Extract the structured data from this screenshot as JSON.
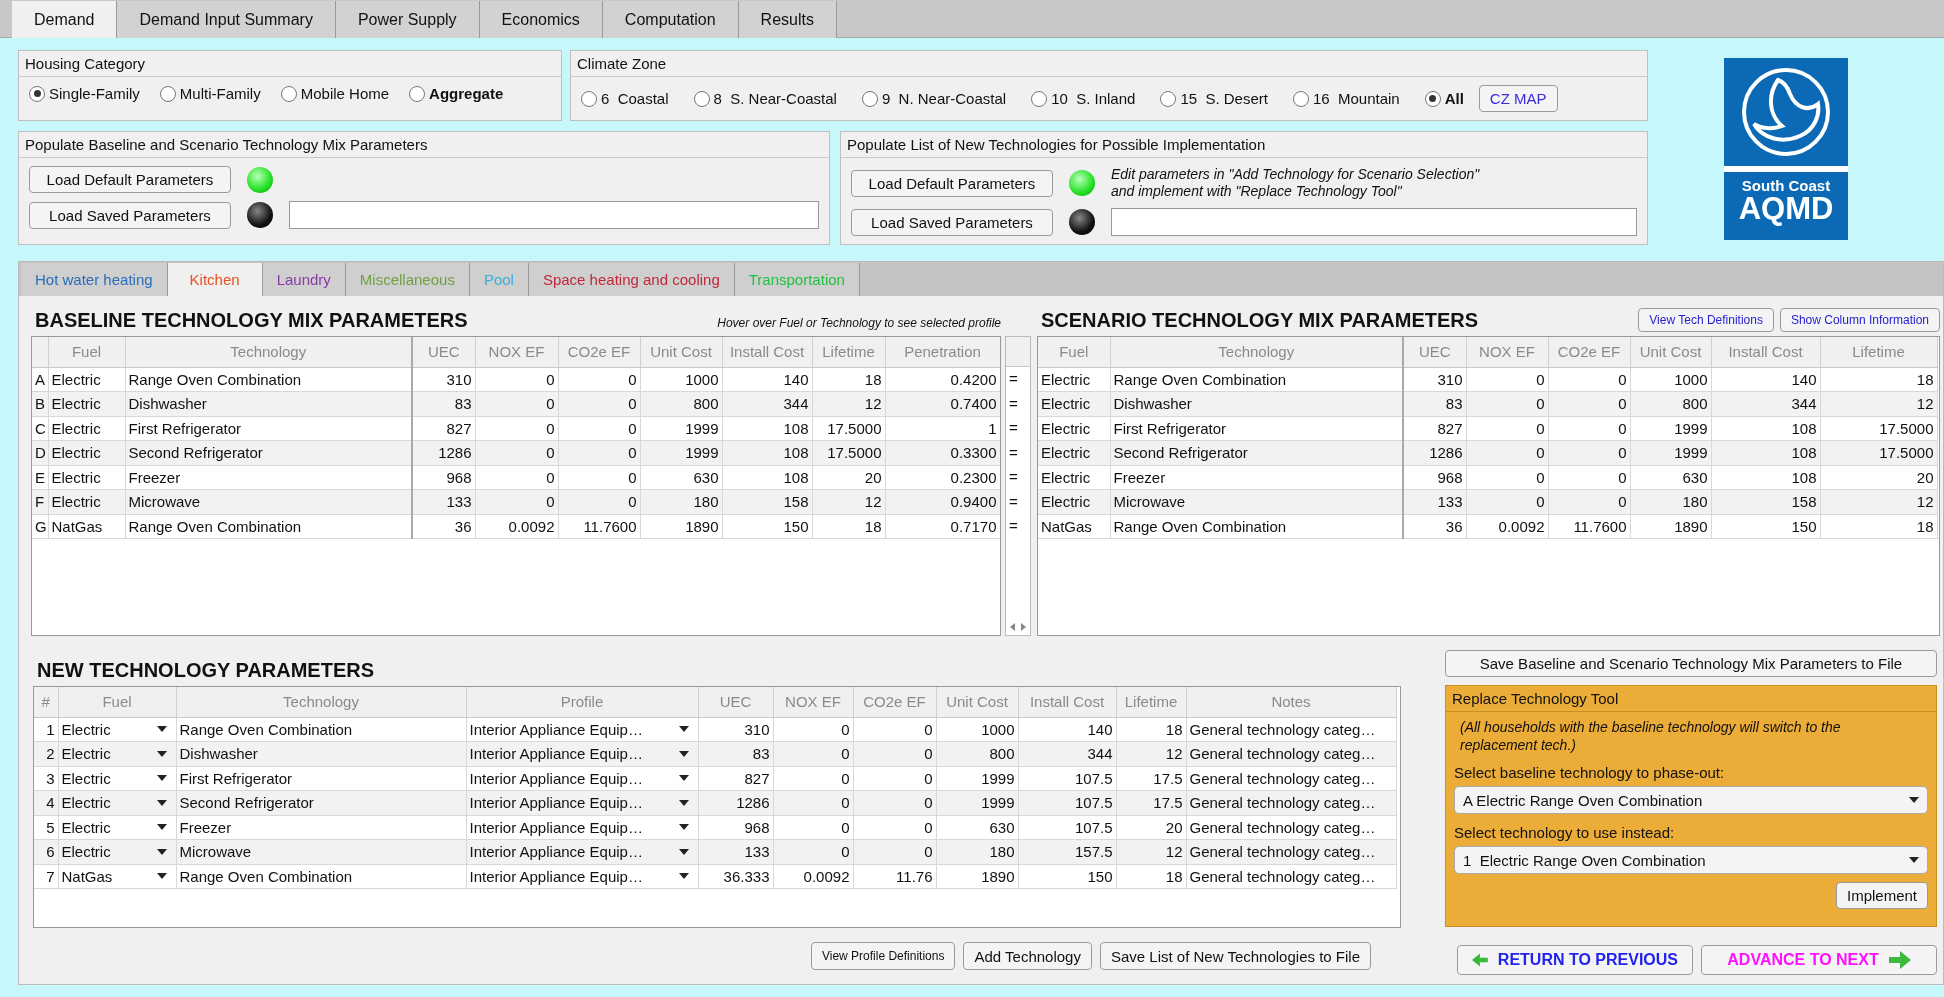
{
  "top_tabs": [
    {
      "label": "Demand",
      "selected": true
    },
    {
      "label": "Demand Input Summary",
      "selected": false
    },
    {
      "label": "Power Supply",
      "selected": false
    },
    {
      "label": "Economics",
      "selected": false
    },
    {
      "label": "Computation",
      "selected": false
    },
    {
      "label": "Results",
      "selected": false
    }
  ],
  "housing_category": {
    "title": "Housing Category",
    "options": [
      {
        "label": "Single-Family",
        "selected": true,
        "kind": "single"
      },
      {
        "label": "Multi-Family",
        "selected": false,
        "kind": "single"
      },
      {
        "label": "Mobile Home",
        "selected": false,
        "kind": "single"
      },
      {
        "label": "Aggregate",
        "selected": false,
        "kind": "total"
      }
    ]
  },
  "climate_zone": {
    "title": "Climate Zone",
    "options": [
      {
        "label": "6  Coastal",
        "selected": false,
        "kind": "single"
      },
      {
        "label": "8  S. Near-Coastal",
        "selected": false,
        "kind": "single"
      },
      {
        "label": "9  N. Near-Coastal",
        "selected": false,
        "kind": "single"
      },
      {
        "label": "10  S. Inland",
        "selected": false,
        "kind": "single"
      },
      {
        "label": "15  S. Desert",
        "selected": false,
        "kind": "single"
      },
      {
        "label": "16  Mountain",
        "selected": false,
        "kind": "single"
      },
      {
        "label": "All",
        "selected": true,
        "kind": "total"
      }
    ],
    "map_button": "CZ MAP"
  },
  "populate_baseline": {
    "title": "Populate Baseline and Scenario Technology Mix Parameters",
    "rows": [
      {
        "kind": "default",
        "button": "Load Default Parameters",
        "on": true
      },
      {
        "kind": "saved",
        "button": "Load Saved Parameters",
        "on": false
      }
    ]
  },
  "populate_new": {
    "title": "Populate List of New Technologies for Possible Implementation",
    "note": "Edit parameters in \"Add Technology for Scenario Selection\"\nand implement with \"Replace Technology Tool\"",
    "rows": [
      {
        "kind": "default",
        "button": "Load Default Parameters",
        "on": true
      },
      {
        "kind": "saved",
        "button": "Load Saved Parameters",
        "on": false
      }
    ]
  },
  "logo": {
    "line1": "South Coast",
    "line2": "AQMD"
  },
  "category_tabs": [
    {
      "label": "Hot water heating",
      "selected": false,
      "color": "#2a6db8"
    },
    {
      "label": "Kitchen",
      "selected": true,
      "color": "#e8501e"
    },
    {
      "label": "Laundry",
      "selected": false,
      "color": "#8a3aa8"
    },
    {
      "label": "Miscellaneous",
      "selected": false,
      "color": "#6fa040"
    },
    {
      "label": "Pool",
      "selected": false,
      "color": "#3aace0"
    },
    {
      "label": "Space heating and cooling",
      "selected": false,
      "color": "#c0283a"
    },
    {
      "label": "Transportation",
      "selected": false,
      "color": "#22c040"
    }
  ],
  "baseline": {
    "title": "BASELINE TECHNOLOGY MIX PARAMETERS",
    "hint": "Hover over Fuel or Technology to see selected profile",
    "columns": [
      "Fuel",
      "Technology",
      "UEC",
      "NOX EF",
      "CO2e EF",
      "Unit Cost",
      "Install Cost",
      "Lifetime",
      "Penetration"
    ],
    "rows": [
      {
        "letter": "A",
        "cells": [
          "Electric",
          "Range Oven Combination",
          "310",
          "0",
          "0",
          "1000",
          "140",
          "18",
          "0.4200"
        ]
      },
      {
        "letter": "B",
        "cells": [
          "Electric",
          "Dishwasher",
          "83",
          "0",
          "0",
          "800",
          "344",
          "12",
          "0.7400"
        ]
      },
      {
        "letter": "C",
        "cells": [
          "Electric",
          "First Refrigerator",
          "827",
          "0",
          "0",
          "1999",
          "108",
          "17.5000",
          "1"
        ]
      },
      {
        "letter": "D",
        "cells": [
          "Electric",
          "Second Refrigerator",
          "1286",
          "0",
          "0",
          "1999",
          "108",
          "17.5000",
          "0.3300"
        ]
      },
      {
        "letter": "E",
        "cells": [
          "Electric",
          "Freezer",
          "968",
          "0",
          "0",
          "630",
          "108",
          "20",
          "0.2300"
        ]
      },
      {
        "letter": "F",
        "cells": [
          "Electric",
          "Microwave",
          "133",
          "0",
          "0",
          "180",
          "158",
          "12",
          "0.9400"
        ]
      },
      {
        "letter": "G",
        "cells": [
          "NatGas",
          "Range Oven Combination",
          "36",
          "0.0092",
          "11.7600",
          "1890",
          "150",
          "18",
          "0.7170"
        ]
      }
    ]
  },
  "scenario": {
    "title": "SCENARIO TECHNOLOGY MIX PARAMETERS",
    "buttons": [
      "View Tech Definitions",
      "Show Column Information"
    ],
    "columns": [
      "Fuel",
      "Technology",
      "UEC",
      "NOX EF",
      "CO2e EF",
      "Unit Cost",
      "Install Cost",
      "Lifetime"
    ],
    "rows": [
      {
        "link": "=",
        "cells": [
          "Electric",
          "Range Oven Combination",
          "310",
          "0",
          "0",
          "1000",
          "140",
          "18"
        ]
      },
      {
        "link": "=",
        "cells": [
          "Electric",
          "Dishwasher",
          "83",
          "0",
          "0",
          "800",
          "344",
          "12"
        ]
      },
      {
        "link": "=",
        "cells": [
          "Electric",
          "First Refrigerator",
          "827",
          "0",
          "0",
          "1999",
          "108",
          "17.5000"
        ]
      },
      {
        "link": "=",
        "cells": [
          "Electric",
          "Second Refrigerator",
          "1286",
          "0",
          "0",
          "1999",
          "108",
          "17.5000"
        ]
      },
      {
        "link": "=",
        "cells": [
          "Electric",
          "Freezer",
          "968",
          "0",
          "0",
          "630",
          "108",
          "20"
        ]
      },
      {
        "link": "=",
        "cells": [
          "Electric",
          "Microwave",
          "133",
          "0",
          "0",
          "180",
          "158",
          "12"
        ]
      },
      {
        "link": "=",
        "cells": [
          "NatGas",
          "Range Oven Combination",
          "36",
          "0.0092",
          "11.7600",
          "1890",
          "150",
          "18"
        ]
      }
    ]
  },
  "new_tech": {
    "title": "NEW TECHNOLOGY PARAMETERS",
    "columns": [
      "#",
      "Fuel",
      "Technology",
      "Profile",
      "UEC",
      "NOX EF",
      "CO2e EF",
      "Unit Cost",
      "Install Cost",
      "Lifetime",
      "Notes"
    ],
    "rows": [
      {
        "cells": [
          "1",
          "Electric",
          "Range Oven Combination",
          "Interior Appliance Equip…",
          "310",
          "0",
          "0",
          "1000",
          "140",
          "18",
          "General technology categ…"
        ]
      },
      {
        "cells": [
          "2",
          "Electric",
          "Dishwasher",
          "Interior Appliance Equip…",
          "83",
          "0",
          "0",
          "800",
          "344",
          "12",
          "General technology categ…"
        ]
      },
      {
        "cells": [
          "3",
          "Electric",
          "First Refrigerator",
          "Interior Appliance Equip…",
          "827",
          "0",
          "0",
          "1999",
          "107.5",
          "17.5",
          "General technology categ…"
        ]
      },
      {
        "cells": [
          "4",
          "Electric",
          "Second Refrigerator",
          "Interior Appliance Equip…",
          "1286",
          "0",
          "0",
          "1999",
          "107.5",
          "17.5",
          "General technology categ…"
        ]
      },
      {
        "cells": [
          "5",
          "Electric",
          "Freezer",
          "Interior Appliance Equip…",
          "968",
          "0",
          "0",
          "630",
          "107.5",
          "20",
          "General technology categ…"
        ]
      },
      {
        "cells": [
          "6",
          "Electric",
          "Microwave",
          "Interior Appliance Equip…",
          "133",
          "0",
          "0",
          "180",
          "157.5",
          "12",
          "General technology categ…"
        ]
      },
      {
        "cells": [
          "7",
          "NatGas",
          "Range Oven Combination",
          "Interior Appliance Equip…",
          "36.333",
          "0.0092",
          "11.76",
          "1890",
          "150",
          "18",
          "General technology categ…"
        ]
      }
    ],
    "buttons": [
      {
        "label": "View Profile Definitions",
        "small": true
      },
      {
        "label": "Add Technology",
        "small": false
      },
      {
        "label": "Save List of New Technologies to File",
        "small": false
      }
    ]
  },
  "save_mix_button": "Save Baseline and Scenario Technology Mix Parameters to File",
  "replace_tool": {
    "title": "Replace Technology Tool",
    "note": "(All households with the baseline technology will switch to the replacement tech.)",
    "baseline_label": "Select baseline technology to phase-out:",
    "baseline_value": "A Electric Range Oven Combination",
    "instead_label": "Select technology to use instead:",
    "instead_value": "1  Electric Range Oven Combination",
    "implement": "Implement"
  },
  "nav": [
    {
      "kind": "back",
      "label": "RETURN TO PREVIOUS"
    },
    {
      "kind": "next",
      "label": "ADVANCE TO NEXT"
    }
  ]
}
